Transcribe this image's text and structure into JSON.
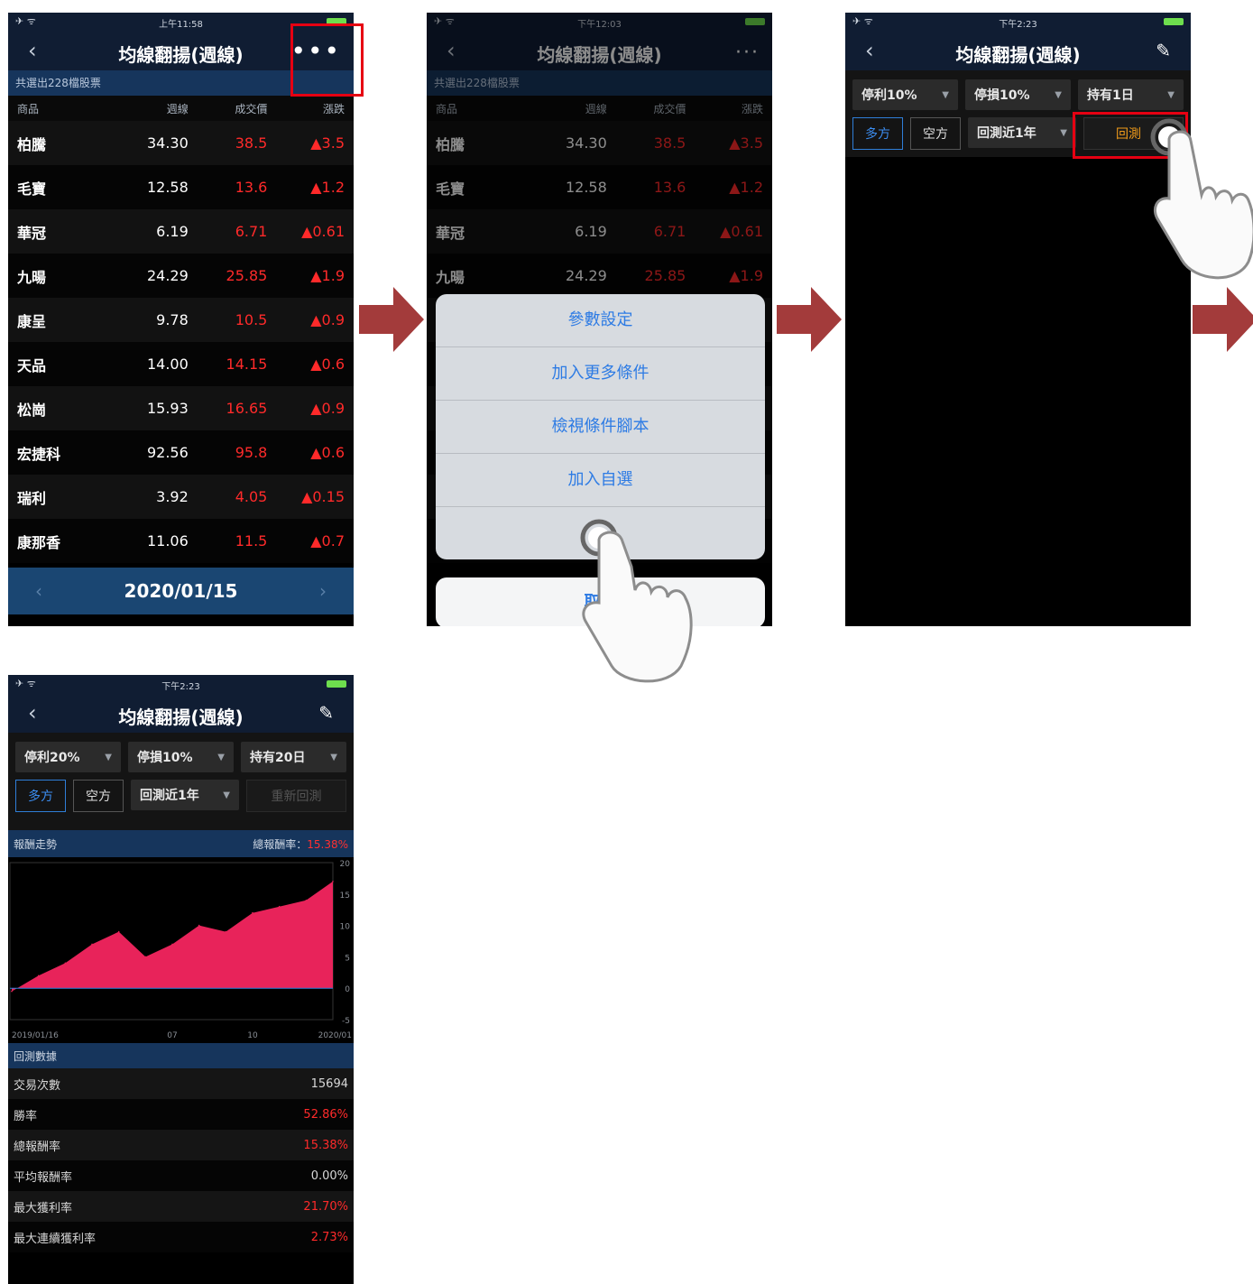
{
  "title": "均線翻揚(週線)",
  "screen1": {
    "time": "上午11:58",
    "subheader": "共選出228檔股票",
    "columns": [
      "商品",
      "週線",
      "成交價",
      "漲跌"
    ],
    "rows": [
      {
        "name": "柏騰",
        "ma": "34.30",
        "price": "38.5",
        "chg": "▲3.5"
      },
      {
        "name": "毛寶",
        "ma": "12.58",
        "price": "13.6",
        "chg": "▲1.2"
      },
      {
        "name": "華冠",
        "ma": "6.19",
        "price": "6.71",
        "chg": "▲0.61"
      },
      {
        "name": "九暘",
        "ma": "24.29",
        "price": "25.85",
        "chg": "▲1.9"
      },
      {
        "name": "康呈",
        "ma": "9.78",
        "price": "10.5",
        "chg": "▲0.9"
      },
      {
        "name": "天品",
        "ma": "14.00",
        "price": "14.15",
        "chg": "▲0.6"
      },
      {
        "name": "松崗",
        "ma": "15.93",
        "price": "16.65",
        "chg": "▲0.9"
      },
      {
        "name": "宏捷科",
        "ma": "92.56",
        "price": "95.8",
        "chg": "▲0.6"
      },
      {
        "name": "瑞利",
        "ma": "3.92",
        "price": "4.05",
        "chg": "▲0.15"
      },
      {
        "name": "康那香",
        "ma": "11.06",
        "price": "11.5",
        "chg": "▲0.7"
      }
    ],
    "date": "2020/01/15",
    "prev": "‹",
    "next": "›"
  },
  "screen2": {
    "time": "下午12:03",
    "menu": [
      "參數設定",
      "加入更多條件",
      "檢視條件腳本",
      "加入自選"
    ],
    "cancel": "取消"
  },
  "screen3": {
    "time": "下午2:23",
    "dd1": "停利10%",
    "dd2": "停損10%",
    "dd3": "持有1日",
    "long": "多方",
    "short": "空方",
    "range": "回測近1年",
    "run": "回測"
  },
  "screen4": {
    "time": "下午2:23",
    "dd1": "停利20%",
    "dd2": "停損10%",
    "dd3": "持有20日",
    "long": "多方",
    "short": "空方",
    "range": "回測近1年",
    "rerun": "重新回測",
    "trend_label": "報酬走勢",
    "total_label": "總報酬率：",
    "total_value": "15.38%",
    "stats_title": "回測數據",
    "stats": [
      {
        "label": "交易次數",
        "value": "15694",
        "red": false
      },
      {
        "label": "勝率",
        "value": "52.86%",
        "red": true
      },
      {
        "label": "總報酬率",
        "value": "15.38%",
        "red": true
      },
      {
        "label": "平均報酬率",
        "value": "0.00%",
        "red": false
      },
      {
        "label": "最大獲利率",
        "value": "21.70%",
        "red": true
      },
      {
        "label": "最大連續獲利率",
        "value": "2.73%",
        "red": true
      }
    ]
  },
  "chart_data": {
    "type": "area",
    "x": [
      "2019/01/16",
      "",
      "",
      "",
      "",
      "",
      "07",
      "",
      "",
      "10",
      "",
      "",
      "2020/01"
    ],
    "xticks": [
      "2019/01/16",
      "07",
      "10",
      "2020/01"
    ],
    "y": [
      -0.5,
      2,
      4,
      7,
      9,
      5,
      7,
      10,
      9,
      12,
      13,
      14,
      17
    ],
    "yticks": [
      "20",
      "15",
      "10",
      "5",
      "0",
      "-5"
    ],
    "ylim": [
      -5,
      20
    ],
    "color": "#e8235a"
  }
}
